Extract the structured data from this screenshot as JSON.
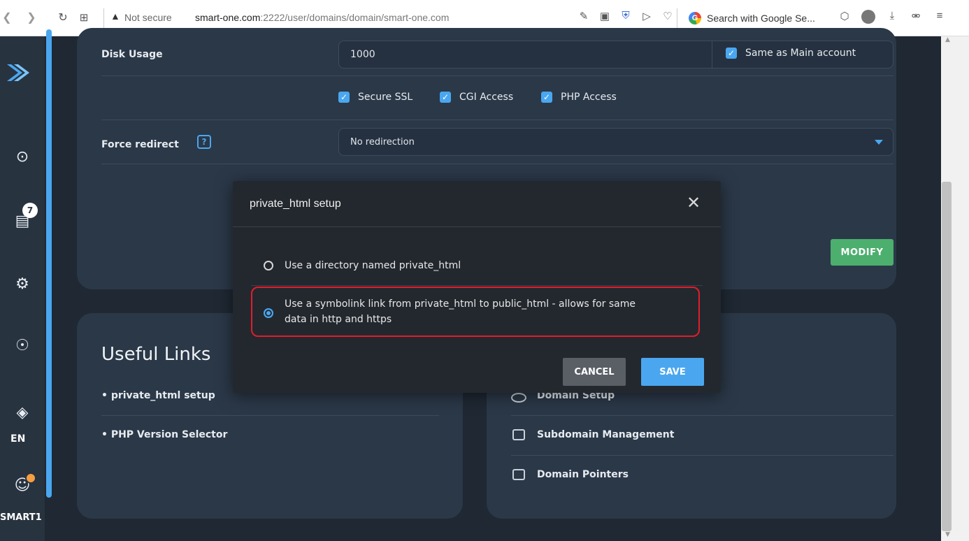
{
  "browser": {
    "security_label": "Not secure",
    "url_host": "smart-one.com",
    "url_path": ":2222/user/domains/domain/smart-one.com",
    "search_placeholder": "Search with Google Se..."
  },
  "sidebar": {
    "messages_badge": "7",
    "language": "EN",
    "user_name": "SMART1"
  },
  "form": {
    "disk_usage_label": "Disk Usage",
    "disk_usage_value": "1000",
    "same_as_main_label": "Same as Main account",
    "secure_ssl_label": "Secure SSL",
    "cgi_access_label": "CGI Access",
    "php_access_label": "PHP Access",
    "force_redirect_label": "Force redirect",
    "help_label": "?",
    "redirect_value": "No redirection",
    "modify_label": "MODIFY"
  },
  "useful_links": {
    "title": "Useful Links",
    "left": [
      "• private_html setup",
      "• PHP Version Selector"
    ],
    "right": [
      "Domain Setup",
      "Subdomain Management",
      "Domain Pointers"
    ]
  },
  "modal": {
    "title": "private_html setup",
    "option1": "Use a directory named private_html",
    "option2_line1": "Use a symbolink link from private_html to public_html - allows for same",
    "option2_line2": "data in http and https",
    "selected_option": 2,
    "cancel_label": "CANCEL",
    "save_label": "SAVE"
  },
  "colors": {
    "accent": "#4aa7ef",
    "success": "#4caf6e",
    "highlight": "#e11d2a"
  }
}
